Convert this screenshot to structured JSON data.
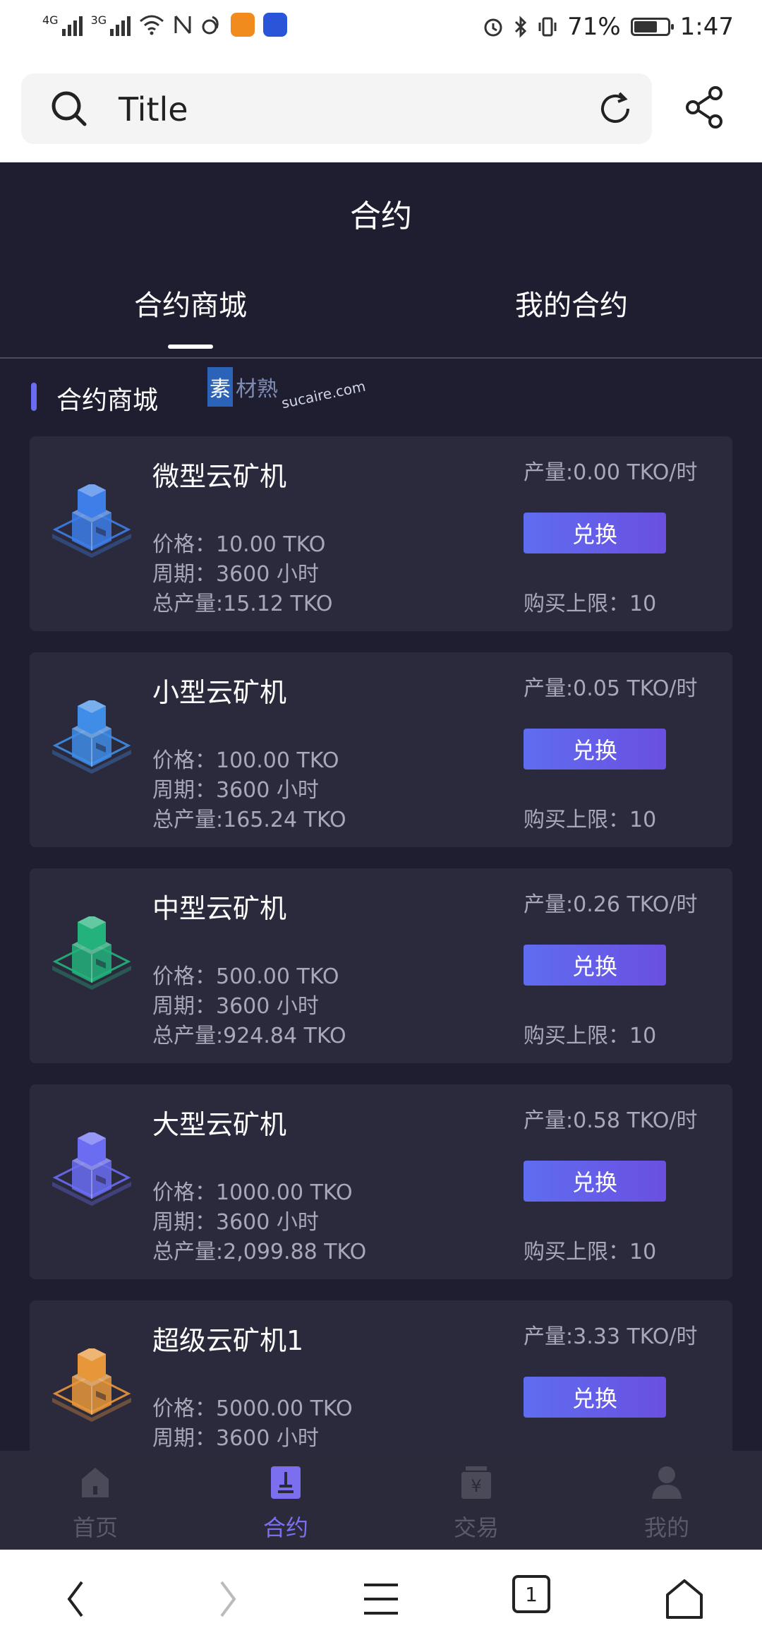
{
  "status_bar": {
    "signal1": "4G",
    "signal2": "3G",
    "battery": "71%",
    "battery_level": 0.71,
    "time": "1:47"
  },
  "browser": {
    "title": "Title"
  },
  "page": {
    "title": "合约",
    "tabs": [
      "合约商城",
      "我的合约"
    ],
    "active_tab": 0,
    "section_title": "合约商城",
    "watermark": {
      "logo": "素",
      "cn": "材熟",
      "url": "sucaire.com"
    }
  },
  "miners": [
    {
      "name": "微型云矿机",
      "price": "价格：10.00 TKO",
      "period": "周期：3600 小时",
      "total": "总产量:15.12 TKO",
      "rate": "产量:0.00 TKO/时",
      "button": "兑换",
      "limit": "购买上限：10",
      "color": "#3d7ee8"
    },
    {
      "name": "小型云矿机",
      "price": "价格：100.00 TKO",
      "period": "周期：3600 小时",
      "total": "总产量:165.24 TKO",
      "rate": "产量:0.05 TKO/时",
      "button": "兑换",
      "limit": "购买上限：10",
      "color": "#3f8de6"
    },
    {
      "name": "中型云矿机",
      "price": "价格：500.00 TKO",
      "period": "周期：3600 小时",
      "total": "总产量:924.84 TKO",
      "rate": "产量:0.26 TKO/时",
      "button": "兑换",
      "limit": "购买上限：10",
      "color": "#22b27a"
    },
    {
      "name": "大型云矿机",
      "price": "价格：1000.00 TKO",
      "period": "周期：3600 小时",
      "total": "总产量:2,099.88 TKO",
      "rate": "产量:0.58 TKO/时",
      "button": "兑换",
      "limit": "购买上限：10",
      "color": "#6a6cf2"
    },
    {
      "name": "超级云矿机1",
      "price": "价格：5000.00 TKO",
      "period": "周期：3600 小时",
      "total": "",
      "rate": "产量:3.33 TKO/时",
      "button": "兑换",
      "limit": "",
      "color": "#e8963a"
    }
  ],
  "tabbar": [
    {
      "label": "首页",
      "icon": "home-icon"
    },
    {
      "label": "合约",
      "icon": "contract-icon"
    },
    {
      "label": "交易",
      "icon": "trade-icon"
    },
    {
      "label": "我的",
      "icon": "profile-icon"
    }
  ],
  "tabbar_active": 1,
  "navbar": {
    "tab_count": "1"
  }
}
